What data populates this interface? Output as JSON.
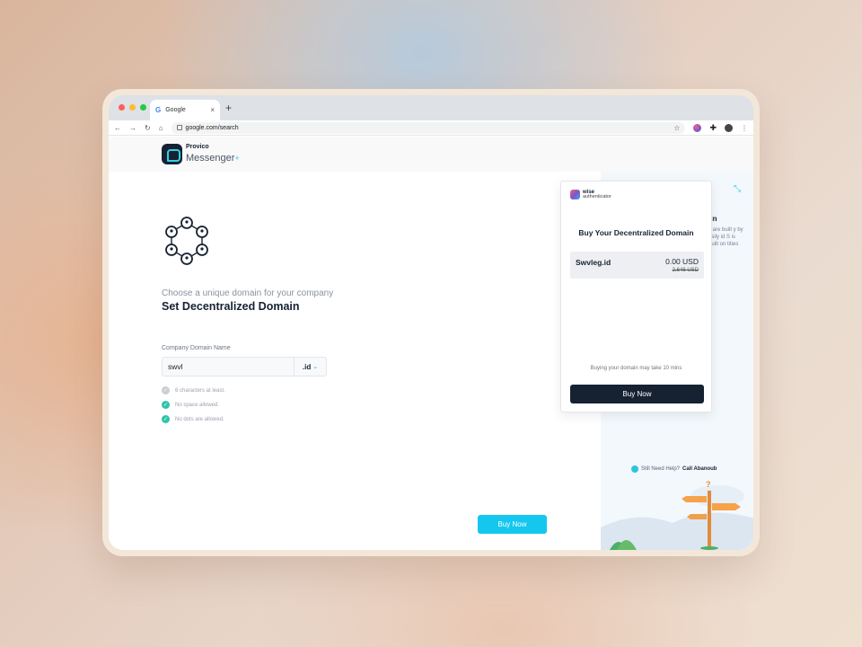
{
  "browser": {
    "tab_title": "Google",
    "tab_icon": "G",
    "tab_close": "×",
    "new_tab": "+",
    "url": "google.com/search"
  },
  "app": {
    "brand_top": "Provico",
    "brand_bottom": "Messenger",
    "brand_plus": "+"
  },
  "form": {
    "subtitle": "Choose a unique domain for your company",
    "heading": "Set Decentralized Domain",
    "field_label": "Company Domain Name",
    "field_value": "swvl",
    "tld": ".id",
    "rules": [
      {
        "text": "6 characters at least.",
        "ok": false
      },
      {
        "text": "No space allowed.",
        "ok": true
      },
      {
        "text": "No dots are allowed.",
        "ok": true
      }
    ],
    "buy_label": "Buy Now"
  },
  "side_panel": {
    "heading": "ain",
    "text": "s are built y by asily id S is built on tities",
    "help_text": "Still Need Help?",
    "help_link": "Call Abanoub"
  },
  "popup": {
    "brand_top": "wise",
    "brand_bottom": "authenticator",
    "title": "Buy Your Decentralized Domain",
    "domain_name": "Swvleg.id",
    "price": "0.00 USD",
    "old_price": "2,646 USD",
    "note": "Buying your domain may take 10 mins",
    "button_label": "Buy Now"
  },
  "colors": {
    "accent": "#14c7ee",
    "navy": "#162232",
    "check_ok": "#2ec5a8",
    "check_off": "#c9ced4"
  }
}
